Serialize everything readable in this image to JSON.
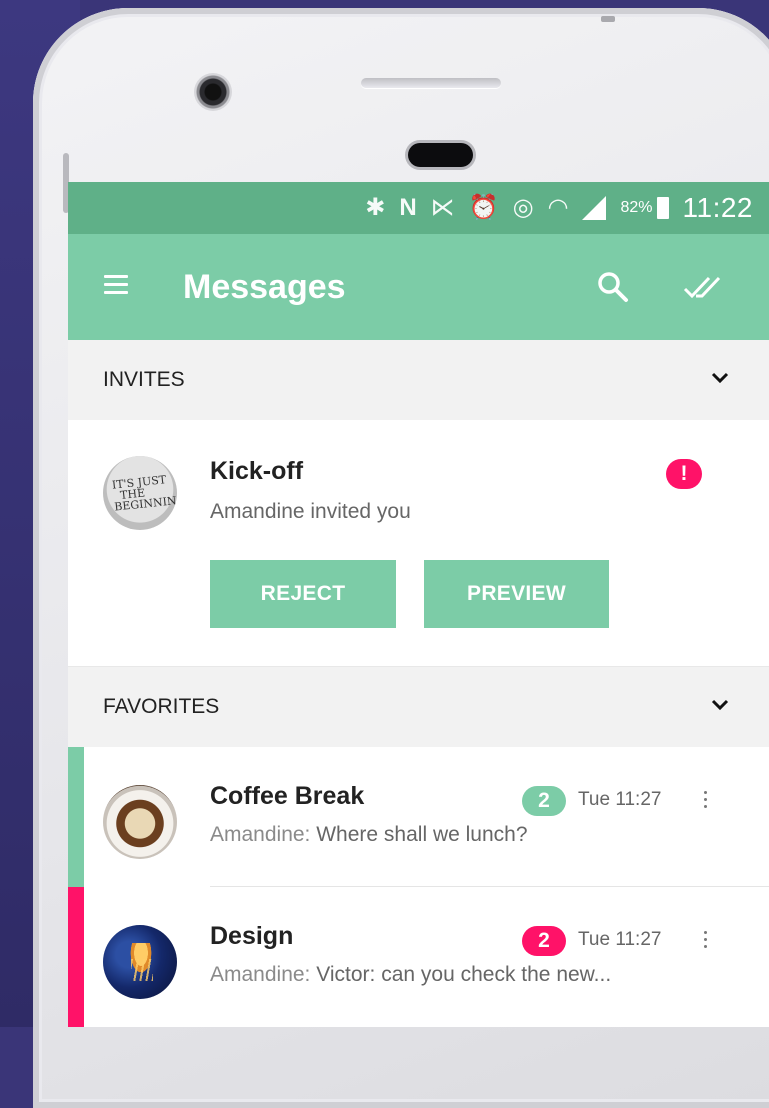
{
  "status_bar": {
    "icons": [
      "bluetooth-icon",
      "nfc-icon",
      "mute-icon",
      "alarm-icon",
      "hotspot-icon",
      "wifi-icon",
      "cell-signal-icon"
    ],
    "battery": "82%",
    "time": "11:22"
  },
  "app_bar": {
    "title": "Messages",
    "actions": [
      "search-icon",
      "mark-all-read-icon"
    ]
  },
  "sections": {
    "invites": {
      "label": "INVITES"
    },
    "favorites": {
      "label": "FAVORITES"
    }
  },
  "invite": {
    "title": "Kick-off",
    "subtitle": "Amandine invited you",
    "alert_badge": "!",
    "reject_label": "REJECT",
    "preview_label": "PREVIEW",
    "avatar_text": "IT'S JUST THE BEGINNING"
  },
  "rooms": [
    {
      "name": "Coffee Break",
      "unread": "2",
      "time": "Tue 11:27",
      "sender": "Amandine:",
      "message": " Where shall we lunch?",
      "accent": "#7ccca7"
    },
    {
      "name": "Design",
      "unread": "2",
      "time": "Tue 11:27",
      "sender": "Amandine:",
      "message": " Victor: can you check the new...",
      "accent": "#ff1268"
    }
  ],
  "colors": {
    "status_bar": "#5fb088",
    "app_bar": "#7ccca7",
    "alert": "#ff1268",
    "background": "#3a3578"
  }
}
